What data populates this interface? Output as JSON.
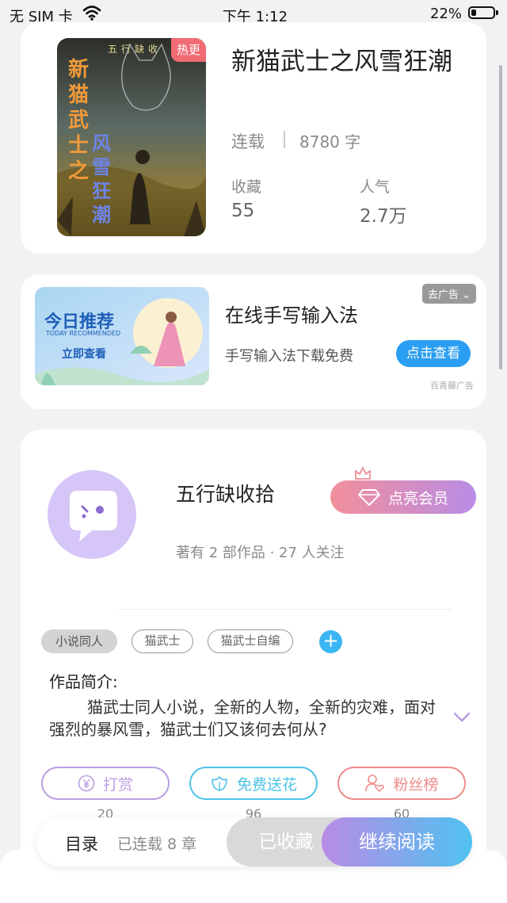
{
  "status_bar": {
    "carrier": "无 SIM 卡",
    "time": "下午 1:12",
    "battery": "22%",
    "battery_level": 0.22
  },
  "book": {
    "hot_badge": "热更",
    "title": "新猫武士之风雪狂潮",
    "status": "连载",
    "word_count": "8780 字",
    "stats": [
      {
        "label": "收藏",
        "value": "55"
      },
      {
        "label": "人气",
        "value": "2.7万"
      }
    ],
    "cover": {
      "top_text": "五行缺收",
      "title_vertical_left": "新猫武士之",
      "title_vertical_right": "风雪狂潮"
    }
  },
  "ad": {
    "close_label": "去广告",
    "title": "在线手写输入法",
    "description": "手写输入法下载免费",
    "button": "点击查看",
    "source": "百青藤广告",
    "image": {
      "heading": "今日推荐",
      "subheading": "TODAY RECOMMENDED",
      "cta": "立即查看"
    }
  },
  "author": {
    "name": "五行缺收拾",
    "vip_button": "点亮会员",
    "meta": "著有 2 部作品 · 27 人关注"
  },
  "tags": [
    "小说同人",
    "猫武士",
    "猫武士自编"
  ],
  "intro": {
    "heading": "作品简介:",
    "text": "猫武士同人小说，全新的人物，全新的灾难，面对强烈的暴风雪，猫武士们又该何去何从?"
  },
  "actions": [
    {
      "label": "打赏",
      "count": "20",
      "color": "#b99ee0"
    },
    {
      "label": "免费送花",
      "count": "96",
      "color": "#4cc3e6"
    },
    {
      "label": "粉丝榜",
      "count": "60",
      "color": "#f08a8a"
    }
  ],
  "bottom_bar": {
    "toc": "目录",
    "serial": "已连载 8 章",
    "collected": "已收藏",
    "continue": "继续阅读"
  }
}
